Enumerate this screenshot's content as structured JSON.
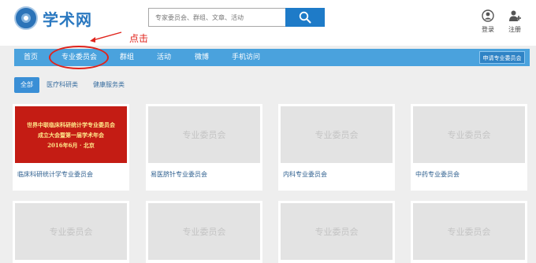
{
  "site": {
    "name": "学术网"
  },
  "search": {
    "placeholder": "专家委员会、群组、文章、活动"
  },
  "user_actions": {
    "login": "登录",
    "register": "注册"
  },
  "annotation": {
    "text": "点击",
    "color": "#e0231b"
  },
  "nav": {
    "items": [
      "首页",
      "专业委员会",
      "群组",
      "活动",
      "微博",
      "手机访问"
    ],
    "apply_label": "申请专业委员会"
  },
  "filters": {
    "items": [
      "全部",
      "医疗科研类",
      "健康服务类"
    ],
    "active": "全部"
  },
  "cards": [
    {
      "caption": "临床科研统计学专业委员会",
      "banner": [
        "世界中联临床科研统计学专业委员会",
        "成立大会暨第一届学术年会",
        "2016年6月 · 北京"
      ]
    },
    {
      "caption": "易医脐针专业委员会",
      "placeholder": "专业委员会"
    },
    {
      "caption": "内科专业委员会",
      "placeholder": "专业委员会"
    },
    {
      "caption": "中药专业委员会",
      "placeholder": "专业委员会"
    },
    {
      "placeholder": "专业委员会"
    },
    {
      "placeholder": "专业委员会"
    },
    {
      "placeholder": "专业委员会"
    },
    {
      "placeholder": "专业委员会"
    }
  ],
  "colors": {
    "nav_bg": "#4aa2dd",
    "accent": "#1e7bc8",
    "banner_bg": "#c41c14"
  },
  "icons": {
    "logo": "globe-icon",
    "search": "search-icon",
    "login": "user-circle-icon",
    "register": "user-add-icon"
  }
}
